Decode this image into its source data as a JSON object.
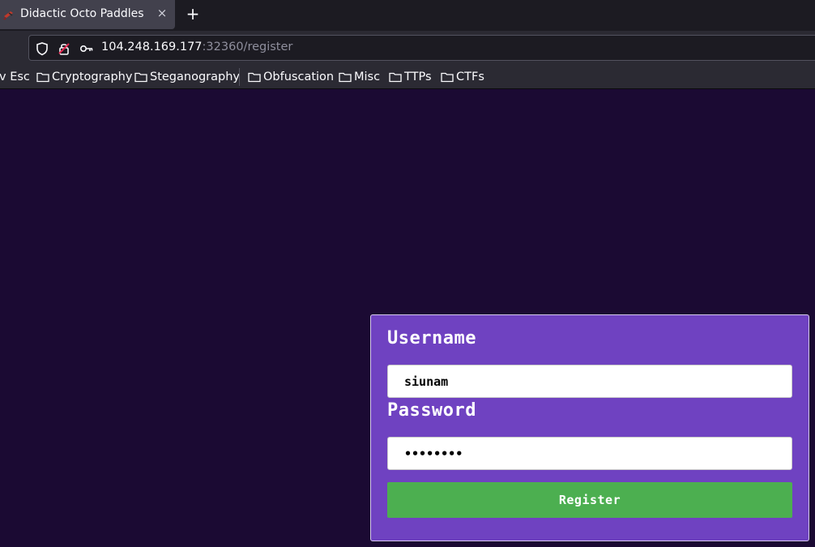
{
  "browser": {
    "tab": {
      "title": "Didactic Octo Paddles",
      "close_label": "×"
    },
    "new_tab_label": "+",
    "url": {
      "host": "104.248.169.177",
      "rest": ":32360/register"
    },
    "bookmarks": [
      {
        "label": "v Esc",
        "folder": false
      },
      {
        "label": "Cryptography",
        "folder": true
      },
      {
        "label": "Steganography",
        "folder": true
      },
      {
        "label": "Obfuscation",
        "folder": true
      },
      {
        "label": "Misc",
        "folder": true
      },
      {
        "label": "TTPs",
        "folder": true
      },
      {
        "label": "CTFs",
        "folder": true
      }
    ]
  },
  "form": {
    "username_label": "Username",
    "username_value": "siunam",
    "password_label": "Password",
    "password_value": "password",
    "submit_label": "Register"
  },
  "colors": {
    "page_background": "#1b0a33",
    "card_background": "#6f42c1",
    "button_background": "#4caf50"
  }
}
